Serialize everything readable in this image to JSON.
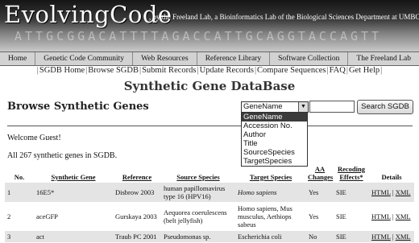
{
  "banner": {
    "logo": "EvolvingCode",
    "tagline": ", by the Freeland Lab, a Bioinformatics Lab of the Biological Sciences Department at UMBC",
    "dna_text": "ATTGCGGACATTTTAGACCATTGCAGGTACCAGTT"
  },
  "nav": [
    "Home",
    "Genetic Code Community",
    "Web Resources",
    "Reference Library",
    "Software Collection",
    "The Freeland Lab"
  ],
  "subnav": [
    "SGDB Home",
    "Browse SGDB",
    "Submit Records",
    "Update Records",
    "Compare Sequences",
    "FAQ",
    "Get Help"
  ],
  "page_title": "Synthetic Gene DataBase",
  "browse": {
    "heading": "Browse Synthetic Genes",
    "select_value": "GeneName",
    "options": [
      "GeneName",
      "Accession No.",
      "Author",
      "Title",
      "SourceSpecies",
      "TargetSpecies"
    ],
    "search_button": "Search SGDB"
  },
  "welcome": "Welcome Guest!",
  "count_text": "All 267 synthetic genes in SGDB.",
  "table": {
    "headers": [
      "No.",
      "Synthetic Gene",
      "Reference",
      "Source Species",
      "Target Species",
      "AA Changes",
      "Recoding Effects*",
      "Details"
    ],
    "rows": [
      {
        "no": "1",
        "gene": "16E5*",
        "ref": "Disbrow 2003",
        "source": "human papillomavirus type 16 (HPV16)",
        "target": "Homo sapiens",
        "aa": "Yes",
        "effects": "SIE",
        "html": "HTML",
        "xml": "XML"
      },
      {
        "no": "2",
        "gene": "aceGFP",
        "ref": "Gurskaya 2003",
        "source": "Aequorea coerulescens (belt jellyfish)",
        "target": "Homo sapiens, Mus musculus, Aethiops sabeus",
        "aa": "Yes",
        "effects": "SIE",
        "html": "HTML",
        "xml": "XML"
      },
      {
        "no": "3",
        "gene": "act",
        "ref": "Traub PC 2001",
        "source": "Pseudomonas sp.",
        "target": "Escherichia coli",
        "aa": "No",
        "effects": "SIE",
        "html": "HTML",
        "xml": "XML"
      }
    ]
  }
}
